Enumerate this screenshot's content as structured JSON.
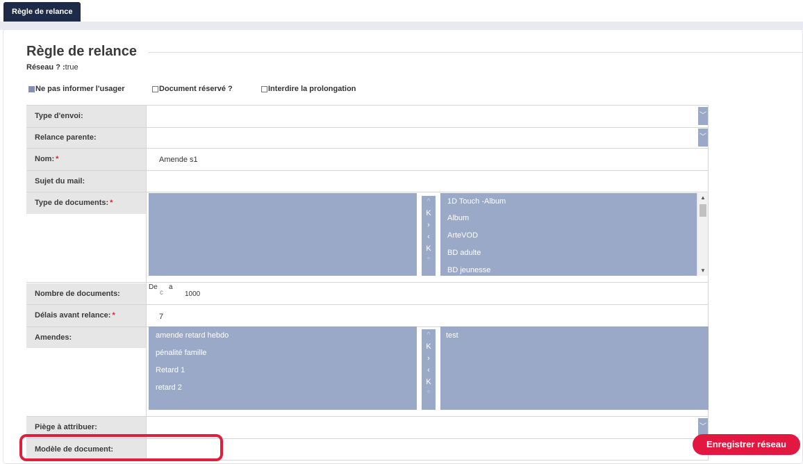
{
  "tab": {
    "label": "Règle de relance"
  },
  "page": {
    "title": "Règle de relance",
    "subtitle_key": "Réseau ? :",
    "subtitle_value": "true"
  },
  "checkboxes": [
    {
      "label": "Ne pas informer l'usager",
      "checked": true
    },
    {
      "label": "Document réservé ?",
      "checked": false
    },
    {
      "label": "Interdire la prolongation",
      "checked": false
    }
  ],
  "fields": {
    "type_envoi": {
      "label": "Type d'envoi:",
      "value": ""
    },
    "relance_parente": {
      "label": "Relance parente:",
      "value": ""
    },
    "nom": {
      "label": "Nom:",
      "required": "*",
      "value": "Amende s1"
    },
    "sujet_mail": {
      "label": "Sujet du mail:",
      "value": ""
    },
    "type_documents": {
      "label": "Type de documents:",
      "required": "*",
      "selected": [
        "1D Touch -Album",
        "Album",
        "ArteVOD",
        "BD adulte",
        "BD jeunesse"
      ]
    },
    "nombre_documents": {
      "label": "Nombre de documents:",
      "from_label": "De",
      "from_value": "c",
      "to_label": "a",
      "to_value": "1000"
    },
    "delais": {
      "label": "Délais avant relance:",
      "required": "*",
      "value": "7"
    },
    "amendes": {
      "label": "Amendes:",
      "available": [
        "amende retard hebdo",
        "pénalité famille",
        "Retard 1",
        "retard 2"
      ],
      "selected": [
        "test"
      ]
    },
    "piege": {
      "label": "Piège à attribuer:",
      "value": ""
    },
    "modele": {
      "label": "Modèle de document:",
      "value": ""
    }
  },
  "mover_glyphs": {
    "all_right": "K",
    "right": "›",
    "left": "‹",
    "all_left": "K",
    "top": "^",
    "bottom": "°"
  },
  "caret": "﹀",
  "actions": {
    "save_label": "Enregistrer réseau"
  },
  "colors": {
    "accent": "#e21840",
    "list_bg": "#9ba9c8",
    "tab_bg": "#1d2a48"
  }
}
